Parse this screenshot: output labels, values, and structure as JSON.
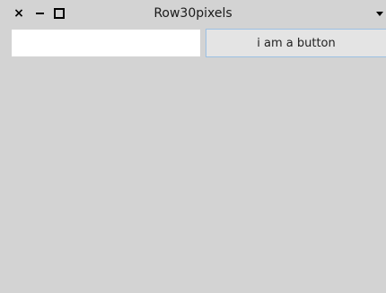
{
  "window": {
    "title": "Row30pixels",
    "controls": {
      "close_glyph": "×",
      "close_icon": "close-icon",
      "minimize_icon": "minimize-icon",
      "maximize_icon": "maximize-icon",
      "menu_icon": "chevron-down-icon"
    }
  },
  "row": {
    "text_field": {
      "value": "",
      "placeholder": ""
    },
    "button_label": "i am a button"
  },
  "colors": {
    "background": "#d3d3d3",
    "input_background": "#ffffff",
    "button_background": "#e4e4e4",
    "button_border": "#9cc0e3"
  }
}
